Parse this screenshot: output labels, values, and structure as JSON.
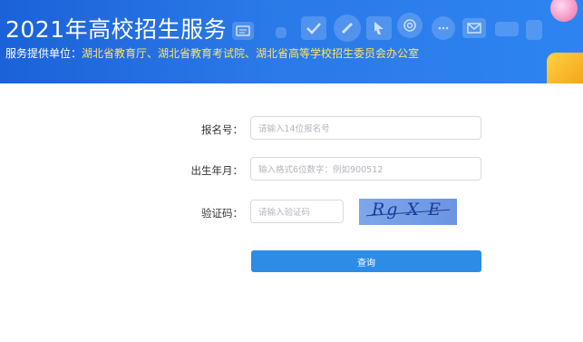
{
  "header": {
    "title": "2021年高校招生服务",
    "subtitle_prefix": "服务提供单位：",
    "subtitle_units": "湖北省教育厅、湖北省教育考试院、湖北省高等学校招生委员会办公室"
  },
  "form": {
    "reg_number": {
      "label": "报名号：",
      "placeholder": "请输入14位报名号"
    },
    "birth": {
      "label": "出生年月：",
      "placeholder": "输入格式6位数字：例如900512"
    },
    "captcha": {
      "label": "验证码：",
      "placeholder": "请输入验证码",
      "image_text": "Rg X E"
    },
    "submit_label": "查询"
  },
  "colors": {
    "banner": "#2a79e8",
    "subtitle_units": "#ffe566",
    "button": "#2d8ce6"
  },
  "icons": [
    "document-icon",
    "checkmark-icon",
    "pen-icon",
    "pointer-icon",
    "at-icon",
    "chat-icon",
    "mail-icon",
    "folder-icon"
  ]
}
